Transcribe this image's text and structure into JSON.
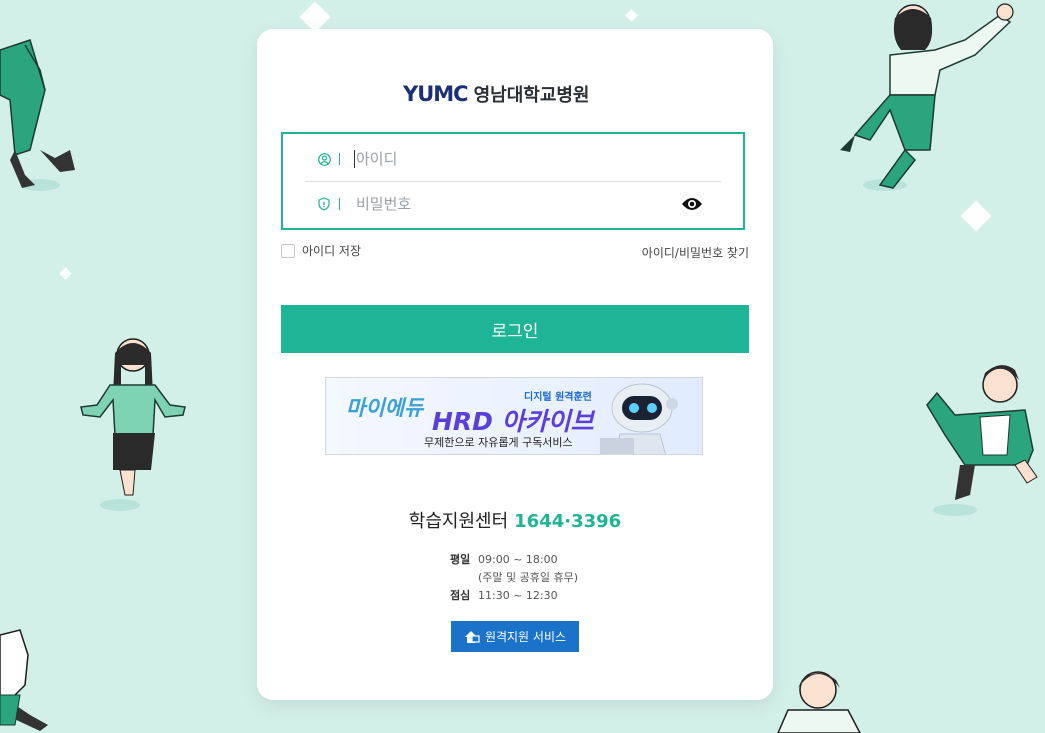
{
  "logo": {
    "mark": "YUMC",
    "name": "영남대학교병원"
  },
  "login": {
    "id_placeholder": "아이디",
    "pw_placeholder": "비밀번호",
    "remember_label": "아이디 저장",
    "find_link": "아이디/비밀번호 찾기",
    "submit_label": "로그인"
  },
  "banner": {
    "title_a": "마이에듀",
    "title_b": "HRD 아카이브",
    "tag": "디지털 원격훈련",
    "subtitle": "무제한으로 자유롭게 구독서비스"
  },
  "support": {
    "title": "학습지원센터",
    "phone": "1644·3396",
    "weekday_label": "평일",
    "weekday_hours": "09:00 ~ 18:00",
    "weekday_note": "(주말 및 공휴일 휴무)",
    "lunch_label": "점심",
    "lunch_hours": "11:30 ~ 12:30",
    "remote_button": "원격지원 서비스"
  },
  "colors": {
    "accent": "#1db595",
    "background": "#d2efe8",
    "remote": "#1a73c9"
  }
}
